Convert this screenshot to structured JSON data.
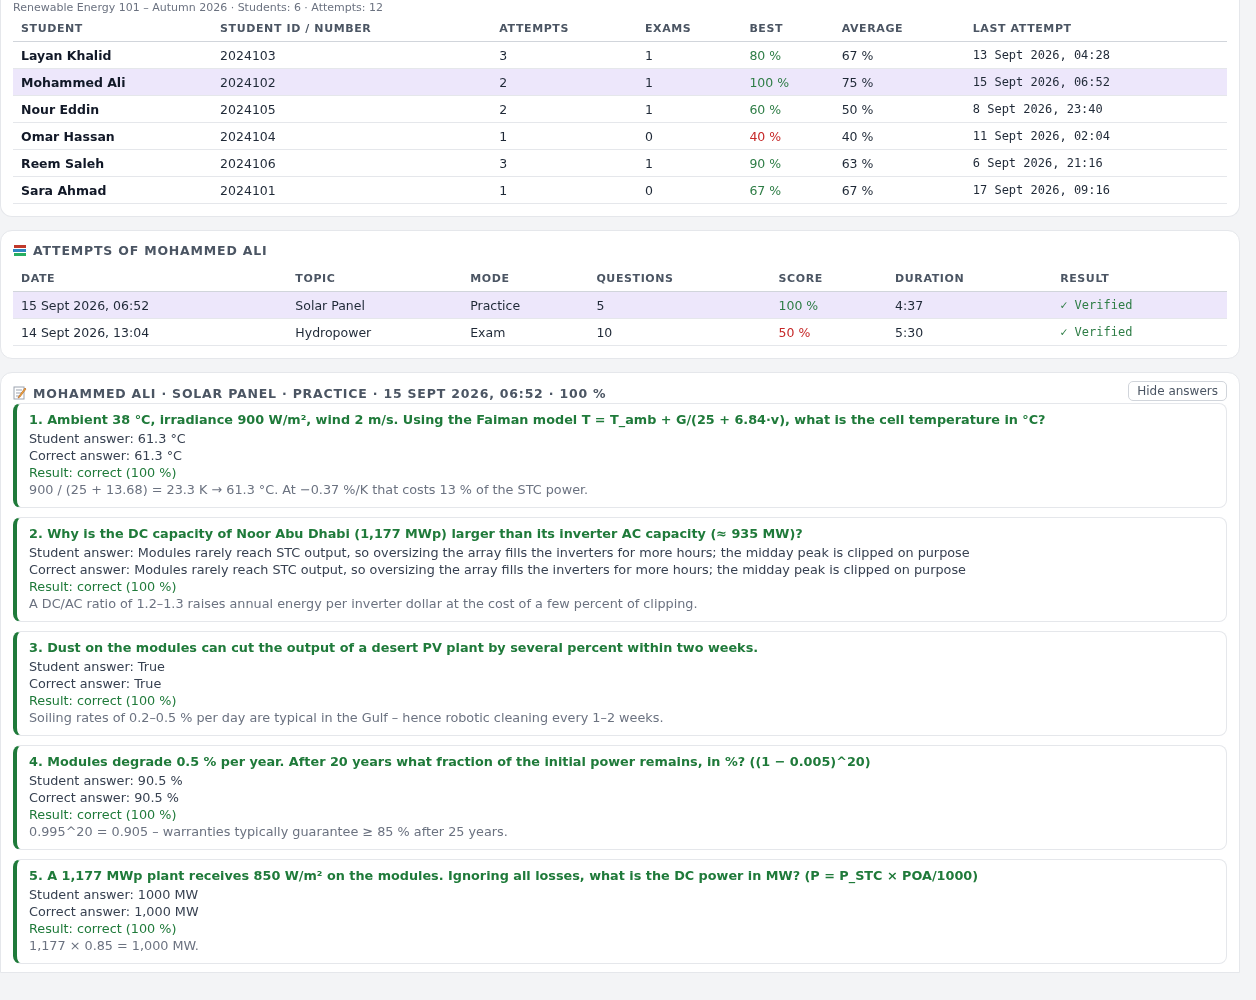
{
  "course_summary": "Renewable Energy 101 – Autumn 2026 · Students: 6 · Attempts: 12",
  "students_table": {
    "columns": [
      "STUDENT",
      "STUDENT ID / NUMBER",
      "ATTEMPTS",
      "EXAMS",
      "BEST",
      "AVERAGE",
      "LAST ATTEMPT"
    ],
    "rows": [
      {
        "name": "Layan Khalid",
        "id": "2024103",
        "attempts": "3",
        "exams": "1",
        "best": "80 %",
        "best_passed": true,
        "average": "67 %",
        "last_attempt": "13 Sept 2026, 04:28",
        "selected": false
      },
      {
        "name": "Mohammed Ali",
        "id": "2024102",
        "attempts": "2",
        "exams": "1",
        "best": "100 %",
        "best_passed": true,
        "average": "75 %",
        "last_attempt": "15 Sept 2026, 06:52",
        "selected": true
      },
      {
        "name": "Nour Eddin",
        "id": "2024105",
        "attempts": "2",
        "exams": "1",
        "best": "60 %",
        "best_passed": true,
        "average": "50 %",
        "last_attempt": "8 Sept 2026, 23:40",
        "selected": false
      },
      {
        "name": "Omar Hassan",
        "id": "2024104",
        "attempts": "1",
        "exams": "0",
        "best": "40 %",
        "best_passed": false,
        "average": "40 %",
        "last_attempt": "11 Sept 2026, 02:04",
        "selected": false
      },
      {
        "name": "Reem Saleh",
        "id": "2024106",
        "attempts": "3",
        "exams": "1",
        "best": "90 %",
        "best_passed": true,
        "average": "63 %",
        "last_attempt": "6 Sept 2026, 21:16",
        "selected": false
      },
      {
        "name": "Sara Ahmad",
        "id": "2024101",
        "attempts": "1",
        "exams": "0",
        "best": "67 %",
        "best_passed": true,
        "average": "67 %",
        "last_attempt": "17 Sept 2026, 09:16",
        "selected": false
      }
    ]
  },
  "attempts_section": {
    "title": "ATTEMPTS OF MOHAMMED ALI",
    "columns": [
      "DATE",
      "TOPIC",
      "MODE",
      "QUESTIONS",
      "SCORE",
      "DURATION",
      "RESULT"
    ],
    "rows": [
      {
        "date": "15 Sept 2026, 06:52",
        "topic": "Solar Panel",
        "mode": "Practice",
        "questions": "5",
        "score": "100 %",
        "score_passed": true,
        "duration": "4:37",
        "result": "✓ Verified",
        "selected": true
      },
      {
        "date": "14 Sept 2026, 13:04",
        "topic": "Hydropower",
        "mode": "Exam",
        "questions": "10",
        "score": "50 %",
        "score_passed": false,
        "duration": "5:30",
        "result": "✓ Verified",
        "selected": false
      }
    ]
  },
  "review_section": {
    "title": "MOHAMMED ALI · SOLAR PANEL · PRACTICE · 15 SEPT 2026, 06:52 · 100 %",
    "hide_button": "Hide answers",
    "questions": [
      {
        "question": "1. Ambient 38 °C, irradiance 900 W/m², wind 2 m/s. Using the Faiman model T = T_amb + G/(25 + 6.84·v), what is the cell temperature in °C?",
        "student_answer": "Student answer: 61.3 °C",
        "correct_answer": "Correct answer: 61.3 °C",
        "result": "Result: correct (100 %)",
        "correct": true,
        "explanation": "900 / (25 + 13.68) = 23.3 K → 61.3 °C. At −0.37 %/K that costs 13 % of the STC power."
      },
      {
        "question": "2. Why is the DC capacity of Noor Abu Dhabi (1,177 MWp) larger than its inverter AC capacity (≈ 935 MW)?",
        "student_answer": "Student answer: Modules rarely reach STC output, so oversizing the array fills the inverters for more hours; the midday peak is clipped on purpose",
        "correct_answer": "Correct answer: Modules rarely reach STC output, so oversizing the array fills the inverters for more hours; the midday peak is clipped on purpose",
        "result": "Result: correct (100 %)",
        "correct": true,
        "explanation": "A DC/AC ratio of 1.2–1.3 raises annual energy per inverter dollar at the cost of a few percent of clipping."
      },
      {
        "question": "3. Dust on the modules can cut the output of a desert PV plant by several percent within two weeks.",
        "student_answer": "Student answer: True",
        "correct_answer": "Correct answer: True",
        "result": "Result: correct (100 %)",
        "correct": true,
        "explanation": "Soiling rates of 0.2–0.5 % per day are typical in the Gulf – hence robotic cleaning every 1–2 weeks."
      },
      {
        "question": "4. Modules degrade 0.5 % per year. After 20 years what fraction of the initial power remains, in %? ((1 − 0.005)^20)",
        "student_answer": "Student answer: 90.5 %",
        "correct_answer": "Correct answer: 90.5 %",
        "result": "Result: correct (100 %)",
        "correct": true,
        "explanation": "0.995^20 = 0.905 – warranties typically guarantee ≥ 85 % after 25 years."
      },
      {
        "question": "5. A 1,177 MWp plant receives 850 W/m² on the modules. Ignoring all losses, what is the DC power in MW? (P = P_STC × POA/1000)",
        "student_answer": "Student answer: 1000 MW",
        "correct_answer": "Correct answer: 1,000 MW",
        "result": "Result: correct (100 %)",
        "correct": true,
        "explanation": "1,177 × 0.85 = 1,000 MW."
      }
    ]
  }
}
